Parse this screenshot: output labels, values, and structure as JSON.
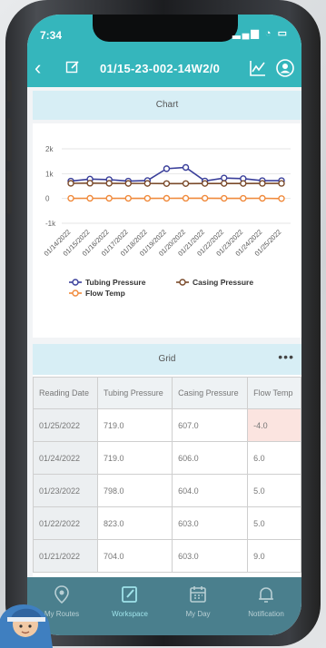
{
  "status": {
    "time": "7:34"
  },
  "appbar": {
    "title": "01/15-23-002-14W2/0"
  },
  "chart_panel": {
    "header": "Chart"
  },
  "chart_data": {
    "type": "line",
    "x": [
      "01/14/2022",
      "01/15/2022",
      "01/16/2022",
      "01/17/2022",
      "01/18/2022",
      "01/19/2022",
      "01/20/2022",
      "01/21/2022",
      "01/22/2022",
      "01/23/2022",
      "01/24/2022",
      "01/25/2022"
    ],
    "y_ticks": [
      "2k",
      "1k",
      "0",
      "-1k"
    ],
    "ylim": [
      -1000,
      2000
    ],
    "grid": true,
    "legend_position": "bottom",
    "series": [
      {
        "name": "Tubing Pressure",
        "color": "#3a3f9a",
        "values": [
          700,
          780,
          760,
          700,
          720,
          1200,
          1250,
          704,
          823,
          798,
          719,
          719
        ]
      },
      {
        "name": "Casing Pressure",
        "color": "#7a4a2a",
        "values": [
          610,
          615,
          610,
          605,
          605,
          600,
          600,
          603,
          603,
          604,
          606,
          607
        ]
      },
      {
        "name": "Flow Temp",
        "color": "#f08a3c",
        "values": [
          5,
          6,
          6,
          5,
          5,
          6,
          7,
          9,
          5,
          5,
          6,
          -4
        ]
      }
    ]
  },
  "grid_panel": {
    "header": "Grid",
    "columns": [
      "Reading Date",
      "Tubing Pressure",
      "Casing Pressure",
      "Flow Temp"
    ],
    "rows": [
      [
        "01/25/2022",
        "719.0",
        "607.0",
        "-4.0"
      ],
      [
        "01/24/2022",
        "719.0",
        "606.0",
        "6.0"
      ],
      [
        "01/23/2022",
        "798.0",
        "604.0",
        "5.0"
      ],
      [
        "01/22/2022",
        "823.0",
        "603.0",
        "5.0"
      ],
      [
        "01/21/2022",
        "704.0",
        "603.0",
        "9.0"
      ]
    ]
  },
  "tabs": [
    "My Routes",
    "Workspace",
    "My Day",
    "Notification"
  ]
}
